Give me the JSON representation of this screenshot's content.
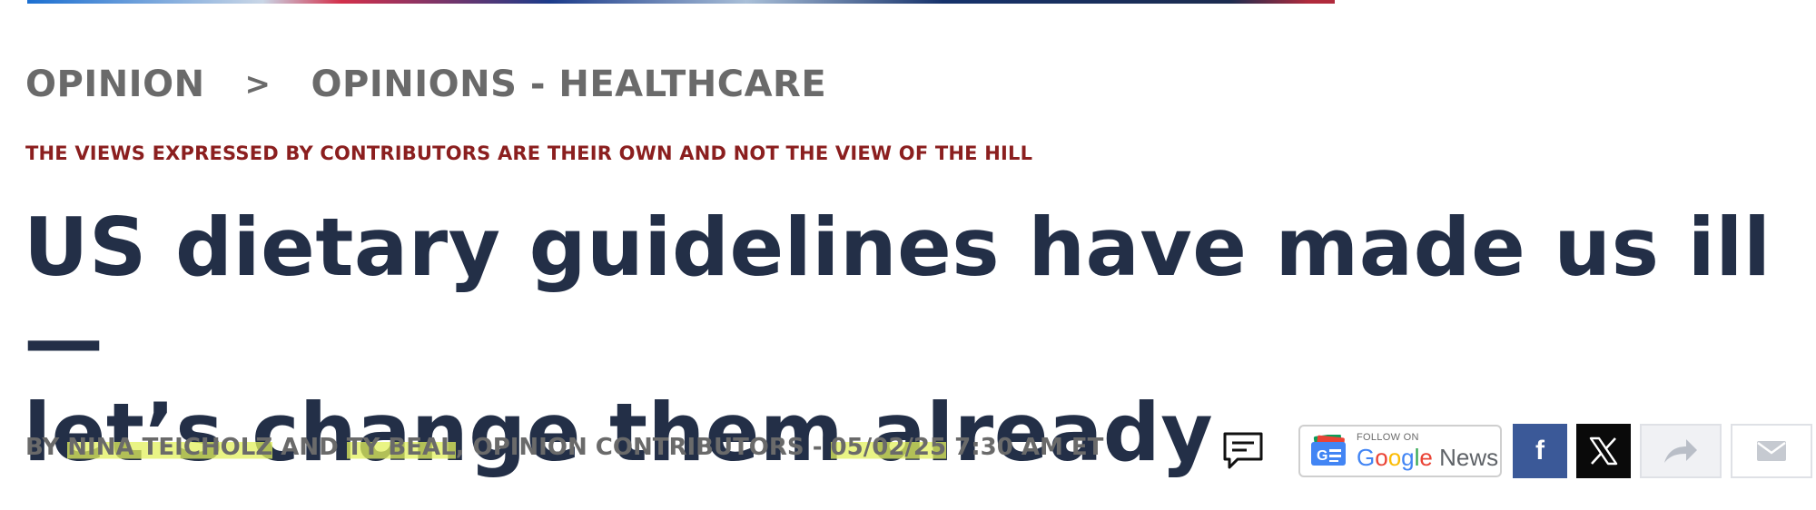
{
  "breadcrumb": {
    "section": "OPINION",
    "separator": ">",
    "subsection": "OPINIONS - HEALTHCARE"
  },
  "disclaimer": "THE VIEWS EXPRESSED BY CONTRIBUTORS ARE THEIR OWN AND NOT THE VIEW OF THE HILL",
  "headline": {
    "line1": "US dietary guidelines have made us ill —",
    "line2": "let’s change them already"
  },
  "byline": {
    "prefix": "BY ",
    "author1": "NINA TEICHOLZ",
    "conjunction": " AND ",
    "author2": "TY BEAL",
    "role": ", OPINION CONTRIBUTORS - ",
    "date": "05/02/25",
    "time": " 7:30 AM ET"
  },
  "share": {
    "google_news_small": "FOLLOW ON",
    "google_news_letters": [
      "G",
      "o",
      "o",
      "g",
      "l",
      "e"
    ],
    "google_news_suffix": " News",
    "facebook_glyph": "f",
    "icons": [
      "comment-icon",
      "google-news-icon",
      "facebook-icon",
      "x-icon",
      "share-arrow-icon",
      "mail-icon"
    ]
  },
  "colors": {
    "headline": "#232f47",
    "breadcrumb": "#6a6a6a",
    "disclaimer": "#8b1f1f",
    "highlight": "#e2f05c",
    "facebook": "#3b5998",
    "x": "#0a0a0a"
  }
}
